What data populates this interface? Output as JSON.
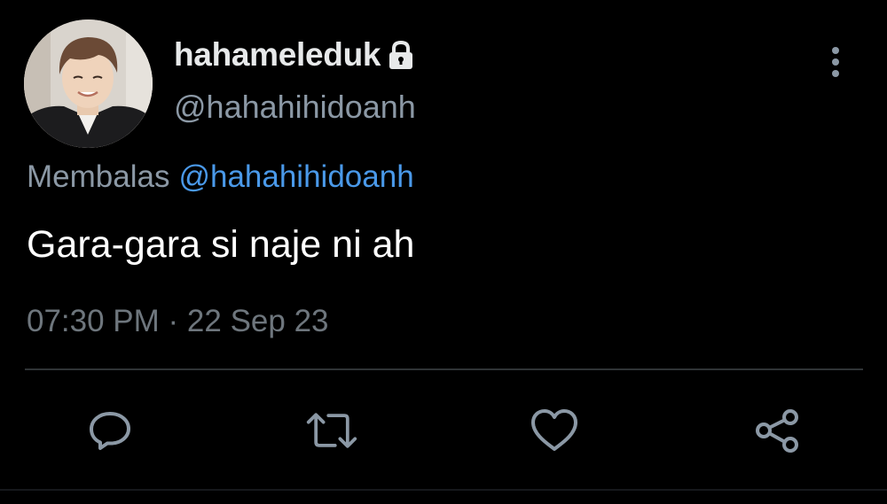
{
  "user": {
    "display_name": "hahameleduk",
    "handle": "@hahahihidoanh",
    "protected_icon": "lock-icon",
    "avatar_icon": "avatar"
  },
  "reply": {
    "prefix": "Membalas",
    "mention": "@hahahihidoanh"
  },
  "tweet": {
    "text": "Gara-gara si naje ni ah",
    "timestamp": "07:30 PM · 22 Sep 23"
  },
  "actions": {
    "reply_icon": "comment-icon",
    "retweet_icon": "retweet-icon",
    "like_icon": "heart-icon",
    "share_icon": "share-icon",
    "more_icon": "more-vertical-icon"
  },
  "colors": {
    "background": "#000000",
    "primary_text": "#e7e9ea",
    "secondary_text": "#8b98a5",
    "mention": "#4a99e9",
    "icon": "#8b98a5",
    "divider": "#2f3336"
  }
}
